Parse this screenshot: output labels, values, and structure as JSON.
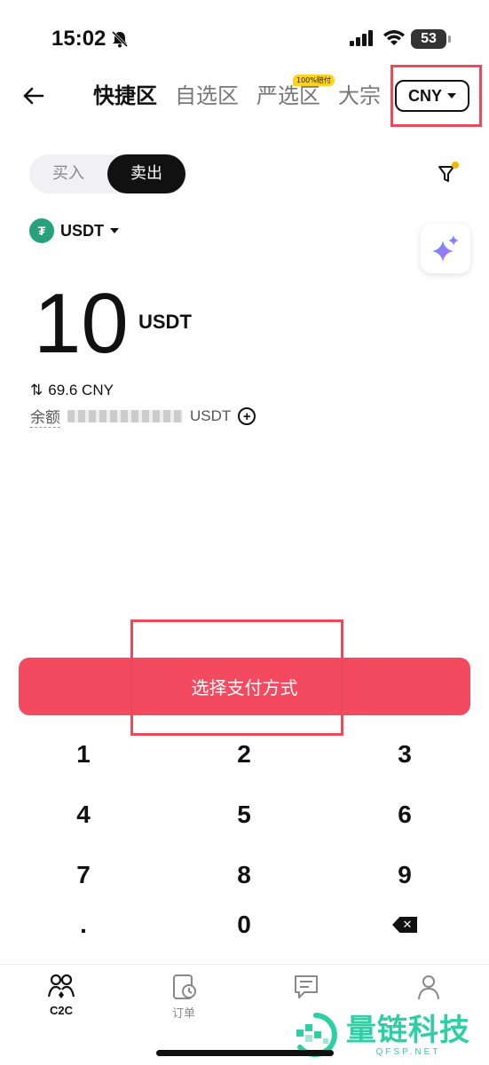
{
  "status_bar": {
    "time": "15:02",
    "battery": "53"
  },
  "header": {
    "tabs": [
      {
        "label": "快捷区"
      },
      {
        "label": "自选区"
      },
      {
        "label": "严选区"
      },
      {
        "label": "大宗"
      }
    ],
    "strict_badge": "100%赔付",
    "currency": "CNY"
  },
  "trade_side": {
    "buy": "买入",
    "sell": "卖出",
    "selected": "卖出"
  },
  "asset": {
    "symbol": "USDT"
  },
  "amount": {
    "value": "10",
    "unit": "USDT",
    "converted": "69.6 CNY"
  },
  "balance": {
    "label": "余额",
    "unit": "USDT"
  },
  "action_button": "选择支付方式",
  "keypad": {
    "keys": [
      "1",
      "2",
      "3",
      "4",
      "5",
      "6",
      "7",
      "8",
      "9",
      ".",
      "0"
    ]
  },
  "bottom_nav": {
    "c2c": "C2C",
    "orders": "订单"
  },
  "watermark": {
    "title": "量链科技",
    "url": "QFSP.NET"
  },
  "colors": {
    "accent": "#f44a5f",
    "highlight": "#ea4b5a",
    "brand": "#2ecfa5"
  }
}
